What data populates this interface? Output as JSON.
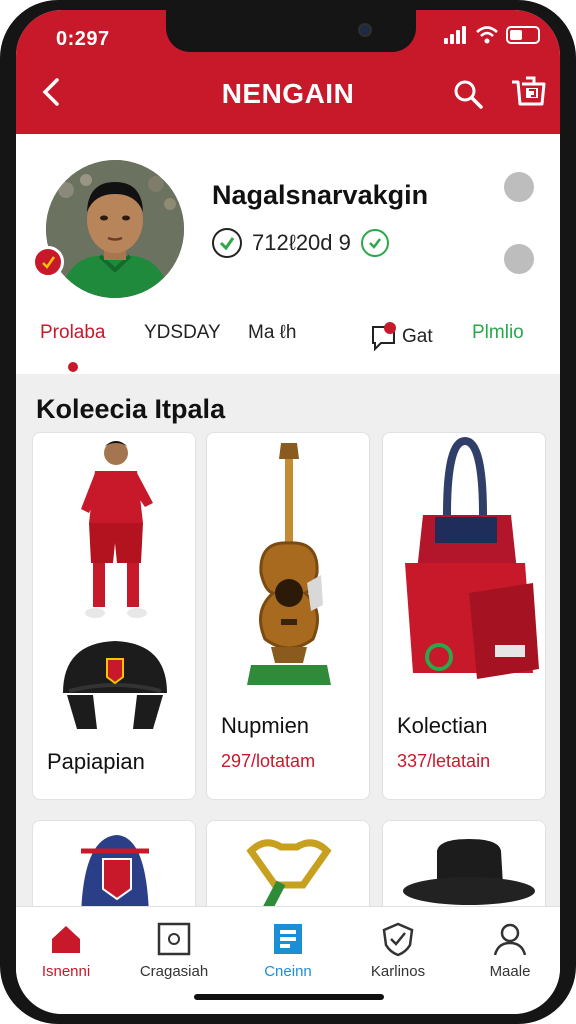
{
  "status": {
    "time": "0:297"
  },
  "header": {
    "title": "NENGAIN",
    "back_icon": "chevron-left-icon",
    "search_icon": "search-icon",
    "cart_icon": "cart-icon"
  },
  "profile": {
    "name": "Nagalsnarvakgin",
    "stats": "712ℓ20d 9",
    "tabs": [
      {
        "label": "Prolaba",
        "active": true
      },
      {
        "label": "YDSDAY"
      },
      {
        "label": "Ma ℓh"
      },
      {
        "label": "Gat"
      },
      {
        "label": "Plmlio",
        "accent": "#2aa84a"
      }
    ]
  },
  "collection": {
    "title": "Koleecia Itpala",
    "items": [
      {
        "name": "Papiapian",
        "price": ""
      },
      {
        "name": "Nupmien",
        "price": "297/lotatam"
      },
      {
        "name": "Kolectian",
        "price": "337/letatain"
      },
      {
        "name": "",
        "price": ""
      },
      {
        "name": "",
        "price": ""
      },
      {
        "name": "",
        "price": ""
      }
    ]
  },
  "bottom_nav": [
    {
      "label": "Isnenni",
      "icon": "home-icon",
      "active": true
    },
    {
      "label": "Cragasiah",
      "icon": "store-icon"
    },
    {
      "label": "Cneinn",
      "icon": "document-icon",
      "accent": "#1b8fd6"
    },
    {
      "label": "Karlinos",
      "icon": "shield-icon"
    },
    {
      "label": "Maale",
      "icon": "profile-icon"
    }
  ],
  "colors": {
    "brand": "#c8192b",
    "accent_green": "#2aa84a",
    "accent_blue": "#1b8fd6"
  }
}
